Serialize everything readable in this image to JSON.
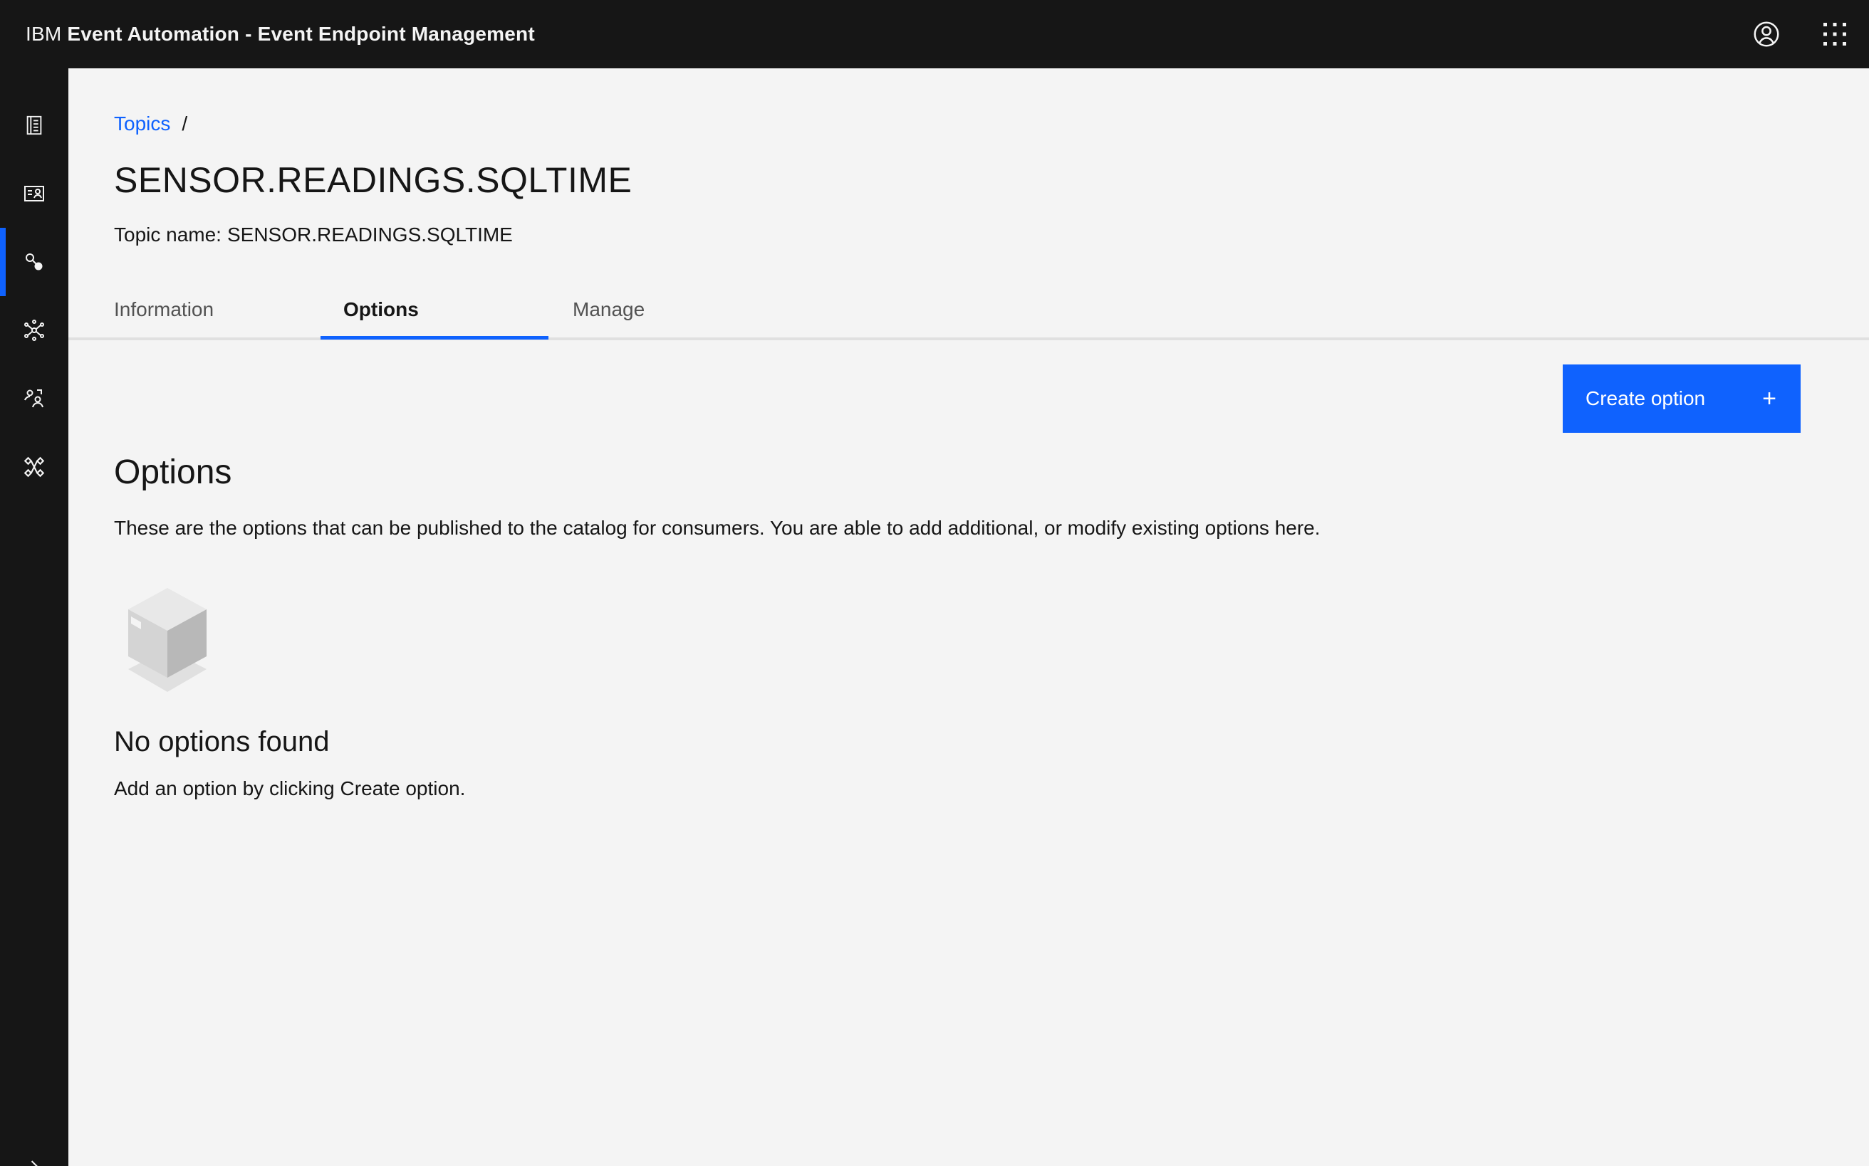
{
  "header": {
    "brand_prefix": "IBM",
    "product_name": "Event Automation - Event Endpoint Management",
    "user_icon": "user-avatar-icon",
    "apps_icon": "app-switcher-icon"
  },
  "sidenav": {
    "items": [
      {
        "id": "catalog",
        "icon": "catalog-icon"
      },
      {
        "id": "subscriptions",
        "icon": "id-card-icon"
      },
      {
        "id": "topics",
        "icon": "topics-icon",
        "active": true
      },
      {
        "id": "gateways",
        "icon": "network-icon"
      },
      {
        "id": "users",
        "icon": "user-access-icon"
      },
      {
        "id": "integrations",
        "icon": "connect-icon"
      }
    ],
    "expand_icon": "chevron-right-icon"
  },
  "breadcrumb": {
    "link": "Topics",
    "separator": "/"
  },
  "page": {
    "title": "SENSOR.READINGS.SQLTIME",
    "topic_name_label": "Topic name:",
    "topic_name_value": "SENSOR.READINGS.SQLTIME"
  },
  "tabs": [
    {
      "label": "Information",
      "active": false
    },
    {
      "label": "Options",
      "active": true
    },
    {
      "label": "Manage",
      "active": false
    }
  ],
  "actions": {
    "create_option_label": "Create option",
    "create_option_icon": "+"
  },
  "options_section": {
    "title": "Options",
    "description": "These are the options that can be published to the catalog for consumers. You are able to add additional, or modify existing options here."
  },
  "empty_state": {
    "illustration": "empty-box-illustration",
    "title": "No options found",
    "description": "Add an option by clicking Create option."
  },
  "colors": {
    "accent": "#0f62fe",
    "header_bg": "#161616",
    "page_bg": "#f4f4f4"
  }
}
